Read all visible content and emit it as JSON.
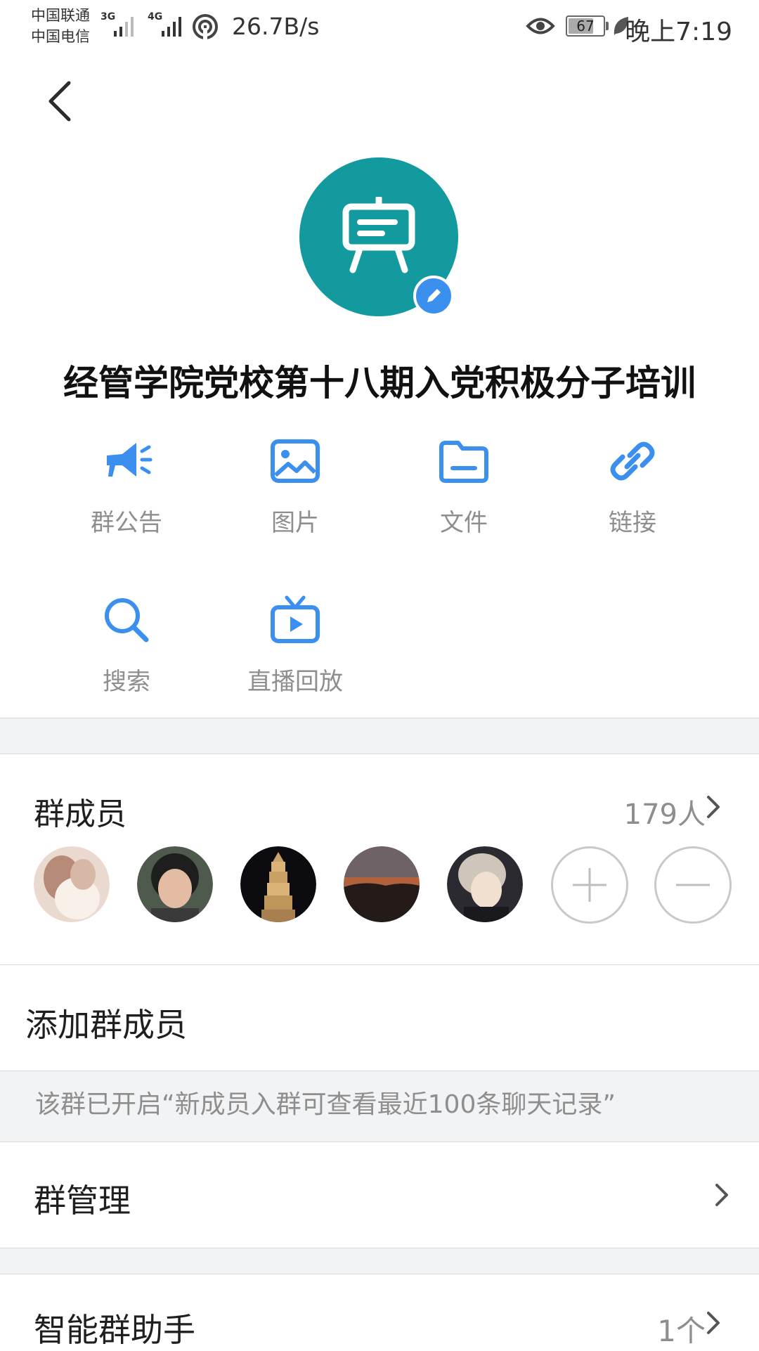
{
  "status_bar": {
    "carrier_1": "中国联通",
    "carrier_2": "中国电信",
    "network_1": "3G",
    "network_2": "4G",
    "net_speed": "26.7B/s",
    "battery": "67",
    "time": "晚上7:19"
  },
  "header": {
    "group_name": "经管学院党校第十八期入党积极分子培训"
  },
  "shortcuts": [
    {
      "label": "群公告",
      "icon": "megaphone-icon"
    },
    {
      "label": "图片",
      "icon": "image-icon"
    },
    {
      "label": "文件",
      "icon": "folder-icon"
    },
    {
      "label": "链接",
      "icon": "link-icon"
    },
    {
      "label": "搜索",
      "icon": "search-icon"
    },
    {
      "label": "直播回放",
      "icon": "tv-play-icon"
    }
  ],
  "members": {
    "title": "群成员",
    "count": "179人",
    "avatars": [
      "member-avatar-1",
      "member-avatar-2",
      "member-avatar-3",
      "member-avatar-4",
      "member-avatar-5"
    ]
  },
  "add_member": {
    "label": "添加群成员"
  },
  "notice": {
    "text": "该群已开启“新成员入群可查看最近100条聊天记录”"
  },
  "group_manage": {
    "label": "群管理"
  },
  "smart_assistant": {
    "label": "智能群助手",
    "value": "1个"
  },
  "colors": {
    "accent": "#3a8fef",
    "avatar_bg": "#139a9f",
    "label_gray": "#8e8e8e",
    "band_bg": "#f2f3f5"
  }
}
